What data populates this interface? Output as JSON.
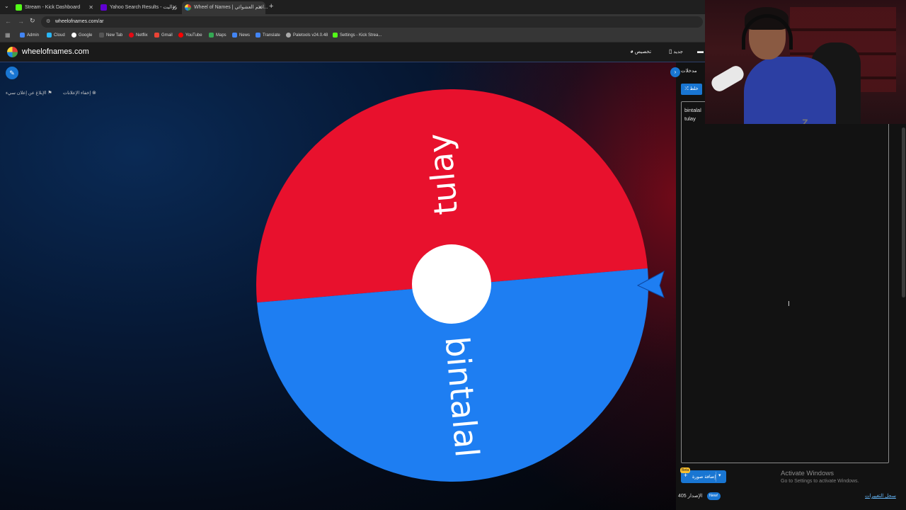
{
  "browser": {
    "tabs": [
      {
        "title": "Stream - Kick Dashboard",
        "color": "#53fc18"
      },
      {
        "title": "Yahoo Search Results - رواليت",
        "color": "#6001d2"
      },
      {
        "title": "Wheel of Names | اسم العشوائي...",
        "color": "#e53935"
      }
    ],
    "new_tab": "+",
    "url": "wheelofnames.com/ar",
    "bookmarks": [
      "Admin",
      "Cloud",
      "Google",
      "New Tab",
      "Netflix",
      "Gmail",
      "YouTube",
      "Maps",
      "News",
      "Translate",
      "Paletools v24.0.48",
      "Settings - Kick Strea..."
    ]
  },
  "site": {
    "logo_text": "wheelofnames.com",
    "header_customize": "تخصيص",
    "header_new": "جديد",
    "hide_ads": "إخفاء الإعلانات",
    "report_ad": "الإبلاغ عن إعلان سيء"
  },
  "wheel": {
    "segments": [
      {
        "label": "tulay",
        "color": "#e8112d"
      },
      {
        "label": "bintalal",
        "color": "#1e7ef2"
      }
    ],
    "pointer_color": "#1e7ef2"
  },
  "panel": {
    "entries_tab": "مدخلات",
    "shuffle_label": "خلط",
    "entries": [
      "bintalal",
      "tulay"
    ],
    "add_image_label": "إضافة صورة",
    "beta_badge": "Beta",
    "version_label": "الإصدار 405",
    "new_badge": "New!",
    "changelog_link": "سجل التغييرات"
  },
  "windows_watermark": {
    "title": "Activate Windows",
    "subtitle": "Go to Settings to activate Windows."
  }
}
